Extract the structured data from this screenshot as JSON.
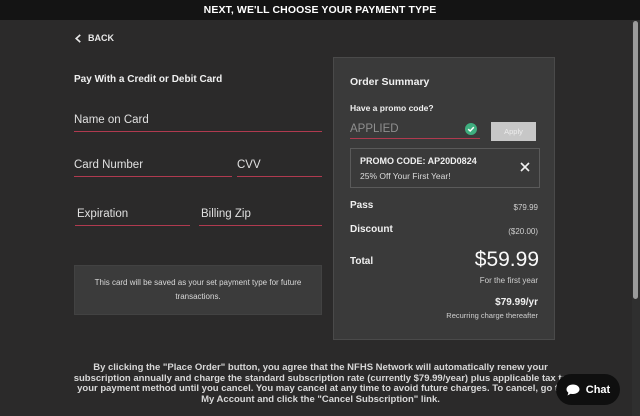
{
  "header": {
    "title": "NEXT,  WE'LL CHOOSE YOUR PAYMENT TYPE"
  },
  "nav": {
    "back_label": "BACK"
  },
  "payment": {
    "section_title": "Pay With a Credit or Debit Card",
    "fields": {
      "name": "Name on Card",
      "number": "Card Number",
      "cvv": "CVV",
      "expiration": "Expiration",
      "zip": "Billing Zip"
    },
    "note": "This card will be saved as your set payment type for future transactions."
  },
  "summary": {
    "title": "Order Summary",
    "promo_prompt": "Have a promo code?",
    "promo_value": "APPLIED",
    "apply_label": "Apply",
    "applied_code": "PROMO CODE: AP20D0824",
    "applied_desc": "25% Off Your First Year!",
    "pass_label": "Pass",
    "pass_value": "$79.99",
    "discount_label": "Discount",
    "discount_value": "($20.00)",
    "total_label": "Total",
    "total_value": "$59.99",
    "total_note": "For the first year",
    "recurring_value": "$79.99/yr",
    "recurring_note": "Recurring charge thereafter"
  },
  "legal": "By clicking the \"Place Order\" button, you agree that the NFHS Network will automatically renew your subscription annually and charge the standard subscription rate (currently $79.99/year) plus applicable tax to your payment method until you cancel. You may cancel at any time to avoid future charges. To cancel, go to My Account and click the \"Cancel Subscription\" link.",
  "chat": {
    "label": "Chat"
  },
  "colors": {
    "accent_underline": "#b03a4f",
    "success_check": "#3fae7f"
  }
}
